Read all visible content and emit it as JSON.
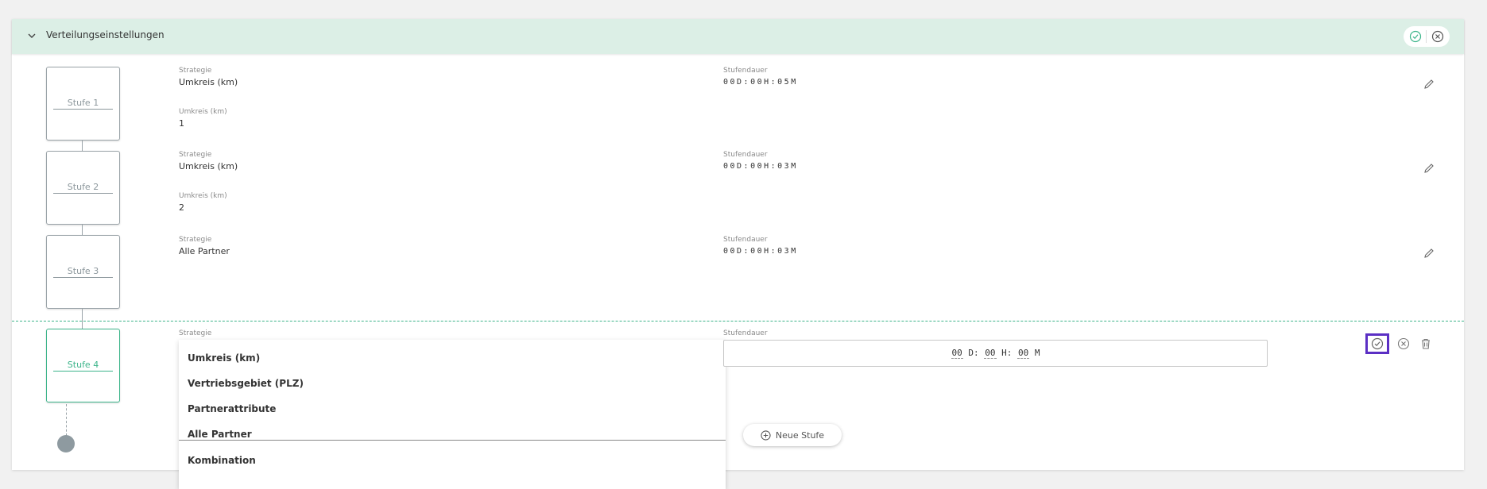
{
  "header": {
    "title": "Verteilungseinstellungen"
  },
  "stages": [
    {
      "label": "Stufe 1",
      "strategy_label": "Strategie",
      "strategy": "Umkreis (km)",
      "duration_label": "Stufendauer",
      "duration": "00D:00H:05M",
      "radius_label": "Umkreis (km)",
      "radius": "1"
    },
    {
      "label": "Stufe 2",
      "strategy_label": "Strategie",
      "strategy": "Umkreis (km)",
      "duration_label": "Stufendauer",
      "duration": "00D:00H:03M",
      "radius_label": "Umkreis (km)",
      "radius": "2"
    },
    {
      "label": "Stufe 3",
      "strategy_label": "Strategie",
      "strategy": "Alle Partner",
      "duration_label": "Stufendauer",
      "duration": "00D:00H:03M"
    }
  ],
  "edit_stage": {
    "label": "Stufe 4",
    "strategy_label": "Strategie",
    "duration_label": "Stufendauer",
    "options": [
      "Umkreis (km)",
      "Vertriebsgebiet (PLZ)",
      "Partnerattribute",
      "Alle Partner",
      "Kombination"
    ],
    "duration": {
      "days": "00",
      "days_unit": "D",
      "hours": "00",
      "hours_unit": "H",
      "minutes": "00",
      "minutes_unit": "M",
      "sep": ":"
    }
  },
  "new_stage_label": "Neue Stufe",
  "colors": {
    "accent": "#3cb48a",
    "header_bg": "#dcefe6",
    "highlight": "#5b2fc4"
  }
}
